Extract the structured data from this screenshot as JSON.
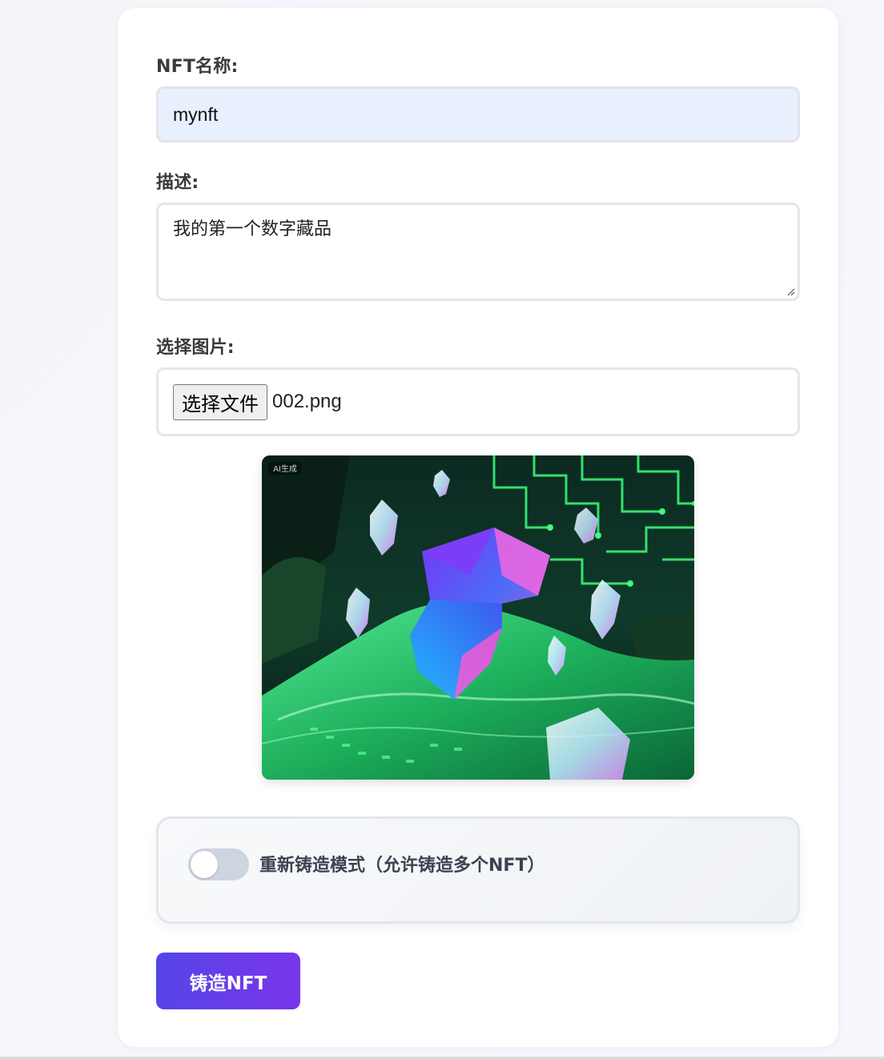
{
  "form": {
    "name_label": "NFT名称:",
    "name_value": "mynft",
    "description_label": "描述:",
    "description_value": "我的第一个数字藏品",
    "image_label": "选择图片:",
    "file_button_label": "选择文件",
    "file_name": "002.png",
    "preview_watermark": "AI生成",
    "remint_toggle_on": false,
    "remint_label": "重新铸造模式（允许铸造多个NFT）",
    "mint_button_label": "铸造NFT"
  },
  "colors": {
    "mint_button_start": "#5545e6",
    "mint_button_end": "#7a35ea",
    "name_input_bg": "#e8f0fe",
    "toggle_off": "#cdd5df"
  }
}
